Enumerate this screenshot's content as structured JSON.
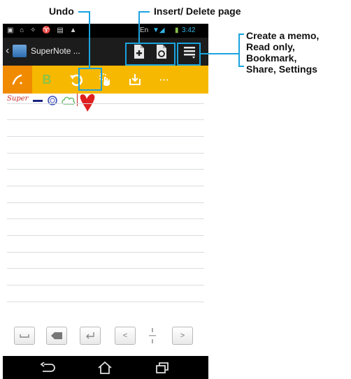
{
  "callouts": {
    "undo": "Undo",
    "insert_delete": "Insert/ Delete page",
    "menu": [
      "Create a memo,",
      "Read only,",
      "Bookmark,",
      "Share, Settings"
    ]
  },
  "status_bar": {
    "time": "3:42",
    "network": "En"
  },
  "title_bar": {
    "app_title": "SuperNote ..."
  },
  "toolbar": {
    "bold_label": "B",
    "more_label": "···"
  },
  "memo": {
    "handwriting": "Super"
  },
  "keyboard": {
    "prev": "<",
    "next": ">"
  },
  "colors": {
    "accent": "#f6b800",
    "highlight": "#1aa3df",
    "dark": "#1c1c1c"
  }
}
